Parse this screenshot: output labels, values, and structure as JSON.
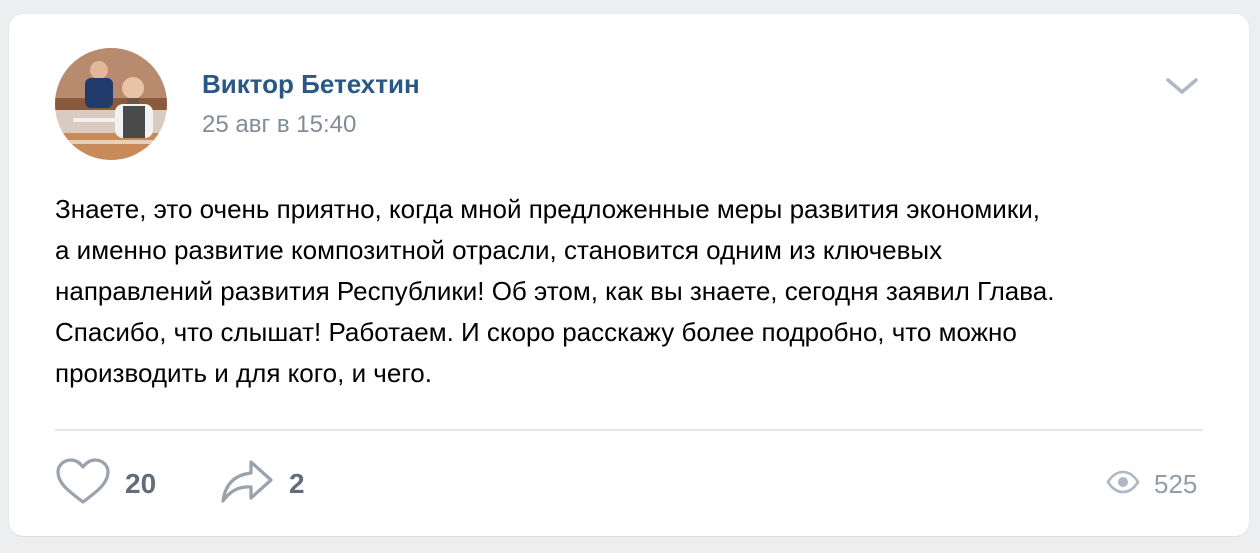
{
  "post": {
    "author": "Виктор Бетехтин",
    "date": "25 авг в 15:40",
    "text_lines": [
      "Знаете, это очень приятно, когда мной предложенные меры развития экономики,",
      "а именно развитие композитной отрасли, становится одним из ключевых",
      "направлений развития Республики! Об этом, как вы знаете, сегодня заявил Глава.",
      "Спасибо, что слышат! Работаем. И скоро расскажу более подробно, что можно",
      "производить и для кого, и чего."
    ]
  },
  "actions": {
    "likes": "20",
    "shares": "2",
    "views": "525"
  },
  "icons": {
    "menu": "chevron-down-icon",
    "like": "heart-icon",
    "share": "share-arrow-icon",
    "views": "eye-icon"
  },
  "colors": {
    "author": "#2a5885",
    "meta": "#818c99",
    "action_count": "#626d7a",
    "icon": "#99a2ad",
    "background": "#edeef0",
    "card": "#ffffff"
  }
}
